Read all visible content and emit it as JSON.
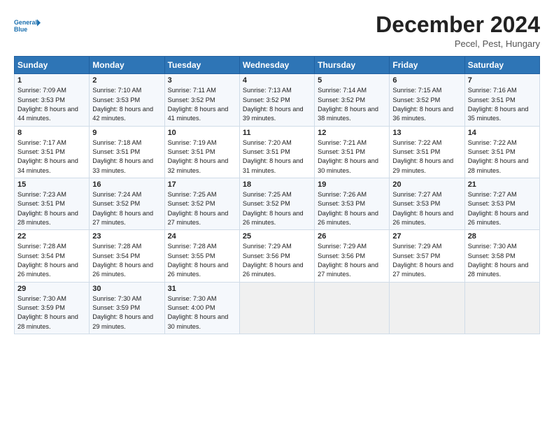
{
  "header": {
    "title": "December 2024",
    "subtitle": "Pecel, Pest, Hungary"
  },
  "columns": [
    "Sunday",
    "Monday",
    "Tuesday",
    "Wednesday",
    "Thursday",
    "Friday",
    "Saturday"
  ],
  "weeks": [
    [
      {
        "day": "1",
        "sunrise": "Sunrise: 7:09 AM",
        "sunset": "Sunset: 3:53 PM",
        "daylight": "Daylight: 8 hours and 44 minutes."
      },
      {
        "day": "2",
        "sunrise": "Sunrise: 7:10 AM",
        "sunset": "Sunset: 3:53 PM",
        "daylight": "Daylight: 8 hours and 42 minutes."
      },
      {
        "day": "3",
        "sunrise": "Sunrise: 7:11 AM",
        "sunset": "Sunset: 3:52 PM",
        "daylight": "Daylight: 8 hours and 41 minutes."
      },
      {
        "day": "4",
        "sunrise": "Sunrise: 7:13 AM",
        "sunset": "Sunset: 3:52 PM",
        "daylight": "Daylight: 8 hours and 39 minutes."
      },
      {
        "day": "5",
        "sunrise": "Sunrise: 7:14 AM",
        "sunset": "Sunset: 3:52 PM",
        "daylight": "Daylight: 8 hours and 38 minutes."
      },
      {
        "day": "6",
        "sunrise": "Sunrise: 7:15 AM",
        "sunset": "Sunset: 3:52 PM",
        "daylight": "Daylight: 8 hours and 36 minutes."
      },
      {
        "day": "7",
        "sunrise": "Sunrise: 7:16 AM",
        "sunset": "Sunset: 3:51 PM",
        "daylight": "Daylight: 8 hours and 35 minutes."
      }
    ],
    [
      {
        "day": "8",
        "sunrise": "Sunrise: 7:17 AM",
        "sunset": "Sunset: 3:51 PM",
        "daylight": "Daylight: 8 hours and 34 minutes."
      },
      {
        "day": "9",
        "sunrise": "Sunrise: 7:18 AM",
        "sunset": "Sunset: 3:51 PM",
        "daylight": "Daylight: 8 hours and 33 minutes."
      },
      {
        "day": "10",
        "sunrise": "Sunrise: 7:19 AM",
        "sunset": "Sunset: 3:51 PM",
        "daylight": "Daylight: 8 hours and 32 minutes."
      },
      {
        "day": "11",
        "sunrise": "Sunrise: 7:20 AM",
        "sunset": "Sunset: 3:51 PM",
        "daylight": "Daylight: 8 hours and 31 minutes."
      },
      {
        "day": "12",
        "sunrise": "Sunrise: 7:21 AM",
        "sunset": "Sunset: 3:51 PM",
        "daylight": "Daylight: 8 hours and 30 minutes."
      },
      {
        "day": "13",
        "sunrise": "Sunrise: 7:22 AM",
        "sunset": "Sunset: 3:51 PM",
        "daylight": "Daylight: 8 hours and 29 minutes."
      },
      {
        "day": "14",
        "sunrise": "Sunrise: 7:22 AM",
        "sunset": "Sunset: 3:51 PM",
        "daylight": "Daylight: 8 hours and 28 minutes."
      }
    ],
    [
      {
        "day": "15",
        "sunrise": "Sunrise: 7:23 AM",
        "sunset": "Sunset: 3:51 PM",
        "daylight": "Daylight: 8 hours and 28 minutes."
      },
      {
        "day": "16",
        "sunrise": "Sunrise: 7:24 AM",
        "sunset": "Sunset: 3:52 PM",
        "daylight": "Daylight: 8 hours and 27 minutes."
      },
      {
        "day": "17",
        "sunrise": "Sunrise: 7:25 AM",
        "sunset": "Sunset: 3:52 PM",
        "daylight": "Daylight: 8 hours and 27 minutes."
      },
      {
        "day": "18",
        "sunrise": "Sunrise: 7:25 AM",
        "sunset": "Sunset: 3:52 PM",
        "daylight": "Daylight: 8 hours and 26 minutes."
      },
      {
        "day": "19",
        "sunrise": "Sunrise: 7:26 AM",
        "sunset": "Sunset: 3:53 PM",
        "daylight": "Daylight: 8 hours and 26 minutes."
      },
      {
        "day": "20",
        "sunrise": "Sunrise: 7:27 AM",
        "sunset": "Sunset: 3:53 PM",
        "daylight": "Daylight: 8 hours and 26 minutes."
      },
      {
        "day": "21",
        "sunrise": "Sunrise: 7:27 AM",
        "sunset": "Sunset: 3:53 PM",
        "daylight": "Daylight: 8 hours and 26 minutes."
      }
    ],
    [
      {
        "day": "22",
        "sunrise": "Sunrise: 7:28 AM",
        "sunset": "Sunset: 3:54 PM",
        "daylight": "Daylight: 8 hours and 26 minutes."
      },
      {
        "day": "23",
        "sunrise": "Sunrise: 7:28 AM",
        "sunset": "Sunset: 3:54 PM",
        "daylight": "Daylight: 8 hours and 26 minutes."
      },
      {
        "day": "24",
        "sunrise": "Sunrise: 7:28 AM",
        "sunset": "Sunset: 3:55 PM",
        "daylight": "Daylight: 8 hours and 26 minutes."
      },
      {
        "day": "25",
        "sunrise": "Sunrise: 7:29 AM",
        "sunset": "Sunset: 3:56 PM",
        "daylight": "Daylight: 8 hours and 26 minutes."
      },
      {
        "day": "26",
        "sunrise": "Sunrise: 7:29 AM",
        "sunset": "Sunset: 3:56 PM",
        "daylight": "Daylight: 8 hours and 27 minutes."
      },
      {
        "day": "27",
        "sunrise": "Sunrise: 7:29 AM",
        "sunset": "Sunset: 3:57 PM",
        "daylight": "Daylight: 8 hours and 27 minutes."
      },
      {
        "day": "28",
        "sunrise": "Sunrise: 7:30 AM",
        "sunset": "Sunset: 3:58 PM",
        "daylight": "Daylight: 8 hours and 28 minutes."
      }
    ],
    [
      {
        "day": "29",
        "sunrise": "Sunrise: 7:30 AM",
        "sunset": "Sunset: 3:59 PM",
        "daylight": "Daylight: 8 hours and 28 minutes."
      },
      {
        "day": "30",
        "sunrise": "Sunrise: 7:30 AM",
        "sunset": "Sunset: 3:59 PM",
        "daylight": "Daylight: 8 hours and 29 minutes."
      },
      {
        "day": "31",
        "sunrise": "Sunrise: 7:30 AM",
        "sunset": "Sunset: 4:00 PM",
        "daylight": "Daylight: 8 hours and 30 minutes."
      },
      null,
      null,
      null,
      null
    ]
  ]
}
